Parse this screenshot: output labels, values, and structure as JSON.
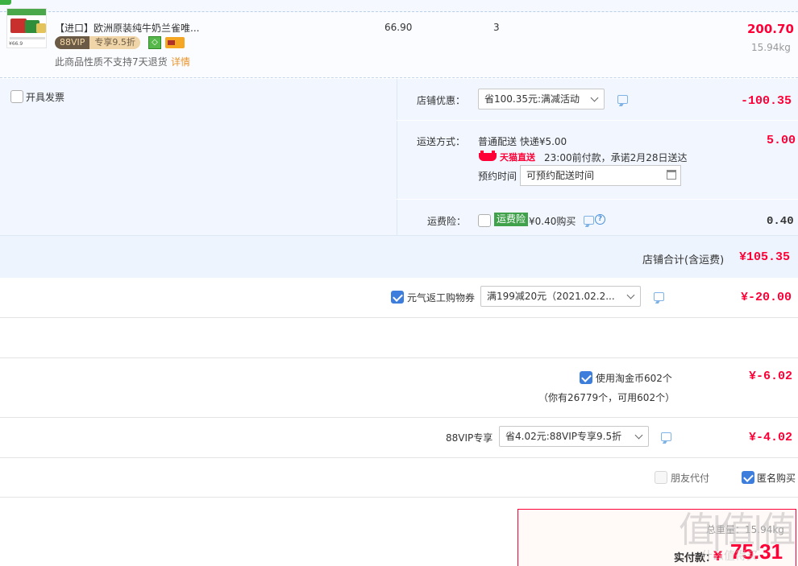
{
  "product": {
    "thumb_price": "¥66.9",
    "title": "【进口】欧洲原装纯牛奶兰雀唯...",
    "vip_left": "88VIP",
    "vip_right": "专享9.5折",
    "no_return": "此商品性质不支持7天退货",
    "detail_link": "详情",
    "unit_price": "66.90",
    "quantity": "3",
    "subtotal": "200.70",
    "weight": "15.94kg"
  },
  "invoice": {
    "label": "开具发票"
  },
  "shop": {
    "discount_label": "店铺优惠：",
    "discount_select": "省100.35元:满减活动",
    "discount_amount": "-100.35",
    "shipping_label": "运送方式：",
    "shipping_method": "普通配送 快递¥5.00",
    "tmall_text": "天猫直送",
    "delivery_promise": "23:00前付款，承诺2月28日送达",
    "schedule_label": "预约时间",
    "schedule_value": "可预约配送时间",
    "shipping_amount": "5.00",
    "insurance_label": "运费险：",
    "insurance_tag": "运费险",
    "insurance_price": "¥0.40购买",
    "insurance_amount": "0.40",
    "total_label": "店铺合计(含运费)",
    "total_amount": "¥105.35"
  },
  "coupon": {
    "label": "元气返工购物券",
    "select": "满199减20元（2021.02.2...",
    "amount": "¥-20.00"
  },
  "taojinbi": {
    "label": "使用淘金币602个",
    "note": "（你有26779个，可用602个）",
    "amount": "¥-6.02"
  },
  "vip88": {
    "label": "88VIP专享",
    "select": "省4.02元:88VIP专享9.5折",
    "amount": "¥-4.02"
  },
  "options": {
    "friend_pay": "朋友代付",
    "anonymous": "匿名购买"
  },
  "final": {
    "weight_label": "总重量：15.94kg",
    "label": "实付款：",
    "yen": "¥",
    "amount": "75.31"
  },
  "watermark": {
    "main": "值|值|值",
    "sub": "什么值得买"
  },
  "colors": {
    "accent": "#ff0036",
    "link": "#e9942a",
    "checkbox": "#3d7edc",
    "panel": "#f2f7ff"
  }
}
